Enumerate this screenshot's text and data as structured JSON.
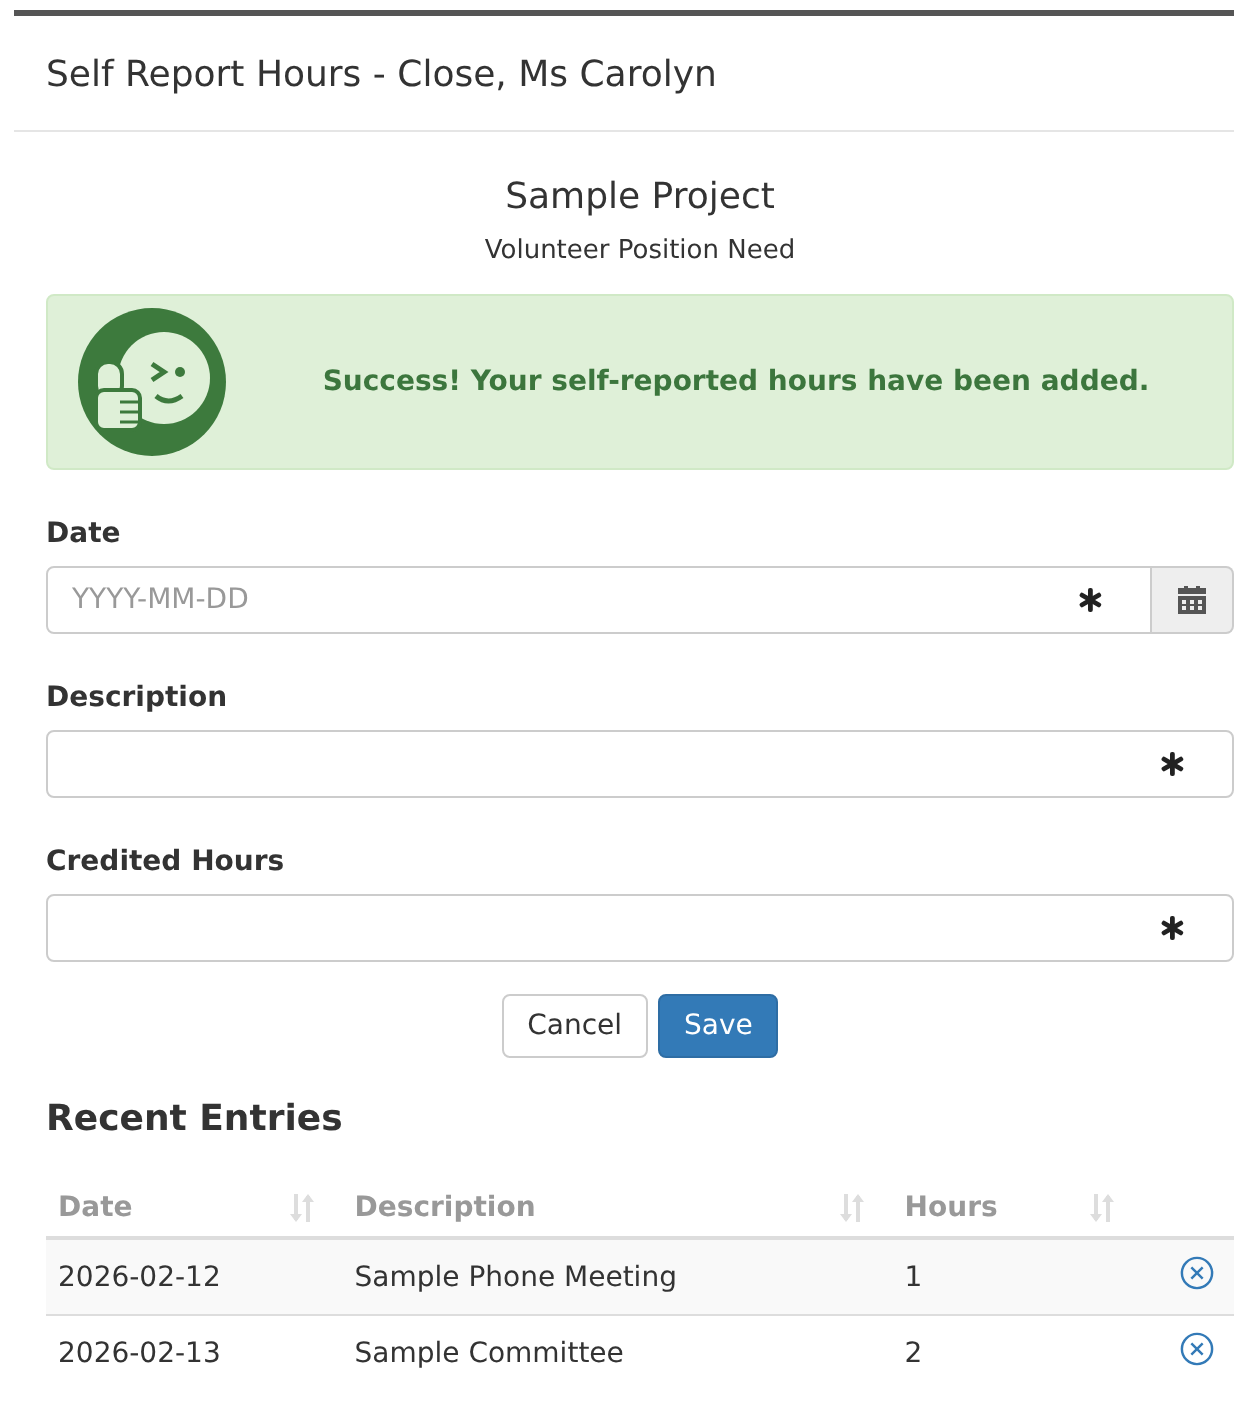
{
  "window": {
    "title": "Self Report Hours - Close, Ms Carolyn"
  },
  "project": {
    "name": "Sample Project",
    "position": "Volunteer Position Need"
  },
  "alert": {
    "message": "Success! Your self-reported hours have been added."
  },
  "fields": [
    {
      "label": "Date",
      "kind": "date",
      "placeholder": "YYYY-MM-DD"
    },
    {
      "label": "Description",
      "kind": "text"
    },
    {
      "label": "Credited Hours",
      "kind": "text"
    }
  ],
  "buttons": [
    {
      "label": "Cancel",
      "kind": "default"
    },
    {
      "label": "Save",
      "kind": "primary"
    }
  ],
  "recent": {
    "title": "Recent Entries",
    "columns": [
      "Date",
      "Description",
      "Hours"
    ],
    "rows": [
      {
        "date": "2026-02-12",
        "description": "Sample Phone Meeting",
        "hours": "1"
      },
      {
        "date": "2026-02-13",
        "description": "Sample Committee",
        "hours": "2"
      }
    ]
  }
}
